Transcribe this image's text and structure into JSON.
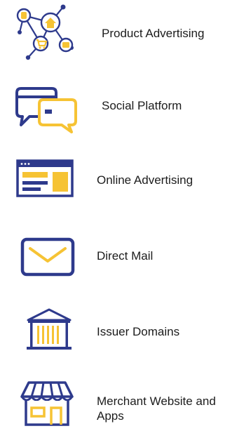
{
  "colors": {
    "navy": "#2e3a8c",
    "yellow": "#f6c334"
  },
  "channels": [
    {
      "label": "Product Advertising",
      "icon": "network-icon"
    },
    {
      "label": "Social Platform",
      "icon": "chat-bubbles-icon"
    },
    {
      "label": "Online Advertising",
      "icon": "browser-window-icon"
    },
    {
      "label": "Direct Mail",
      "icon": "envelope-icon"
    },
    {
      "label": "Issuer Domains",
      "icon": "bank-building-icon"
    },
    {
      "label": "Merchant Website and Apps",
      "icon": "storefront-icon"
    }
  ]
}
